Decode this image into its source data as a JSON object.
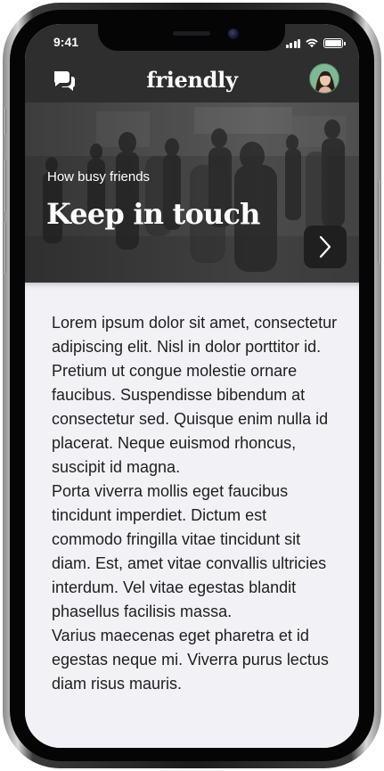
{
  "status_bar": {
    "time": "9:41",
    "icons": [
      "cellular-signal-icon",
      "wifi-icon",
      "battery-icon"
    ]
  },
  "header": {
    "title": "friendly",
    "left_icon": "chat-bubbles-icon",
    "right_avatar": "user-avatar"
  },
  "hero": {
    "subtitle": "How busy friends",
    "title": "Keep in touch",
    "next_icon": "chevron-right-icon",
    "background": "blurred crowd photo"
  },
  "article": {
    "paragraphs": [
      "Lorem ipsum dolor sit amet, consectetur adipiscing elit. Nisl in dolor porttitor id. Pretium ut congue molestie ornare faucibus. Suspendisse bibendum at consectetur sed. Quisque enim nulla id placerat. Neque euismod rhoncus, suscipit id magna.",
      "Porta viverra mollis eget faucibus tincidunt imperdiet. Dictum est commodo fringilla vitae tincidunt sit diam. Est, amet vitae convallis ultricies interdum. Vel vitae egestas blandit phasellus facilisis massa.",
      "Varius maecenas eget pharetra et id egestas neque mi. Viverra purus lectus diam risus mauris."
    ]
  },
  "colors": {
    "header_bg": "#2e2e2e",
    "content_bg": "#f2f2f6",
    "text": "#1e1e1e",
    "button_bg": "#1f1f1f"
  }
}
